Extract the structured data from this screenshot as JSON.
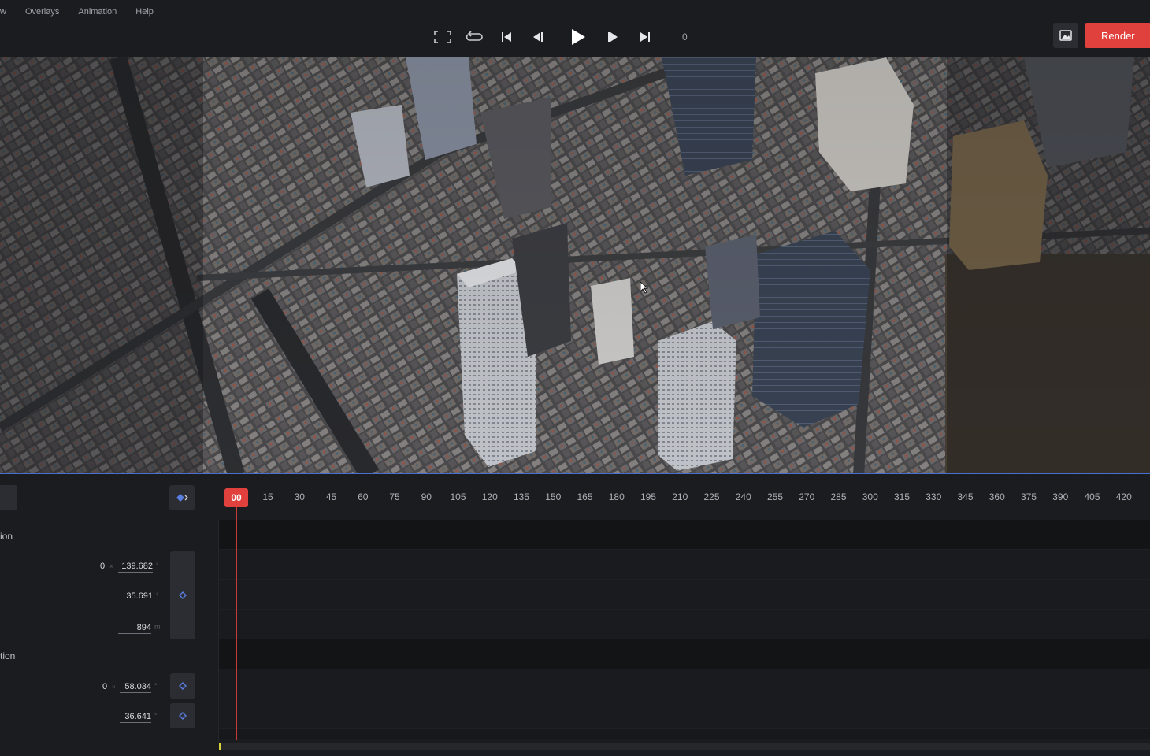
{
  "menu": {
    "items": [
      "w",
      "Overlays",
      "Animation",
      "Help"
    ]
  },
  "transport": {
    "frame": "0",
    "buttons": [
      "fullscreen-icon",
      "loop-icon",
      "skip-to-start-icon",
      "step-back-icon",
      "play-icon",
      "step-forward-icon",
      "skip-to-end-icon"
    ]
  },
  "toolbar": {
    "render_label": "Render",
    "snapshot_icon": "image-icon"
  },
  "timeline": {
    "playhead_label": "00",
    "ticks": [
      "15",
      "30",
      "45",
      "60",
      "75",
      "90",
      "105",
      "120",
      "135",
      "150",
      "165",
      "180",
      "195",
      "210",
      "225",
      "240",
      "255",
      "270",
      "285",
      "300",
      "315",
      "330",
      "345",
      "360",
      "375",
      "390",
      "405",
      "420",
      "4"
    ]
  },
  "panel": {
    "section1": {
      "label": "ion",
      "prefix": "0",
      "lon": {
        "value": "139.682",
        "unit": "°"
      },
      "lat": {
        "value": "35.691",
        "unit": "°"
      },
      "alt": {
        "value": "894",
        "unit": "m"
      }
    },
    "section2": {
      "label": "tion",
      "prefix": "0",
      "a": {
        "value": "58.034",
        "unit": "°"
      },
      "b": {
        "value": "36.641",
        "unit": "°"
      }
    }
  },
  "colors": {
    "accent": "#e0413c",
    "selection": "#4a6fd0",
    "keyframe": "#5b7fe0",
    "scrollbar_thumb": "#d8d23a"
  }
}
